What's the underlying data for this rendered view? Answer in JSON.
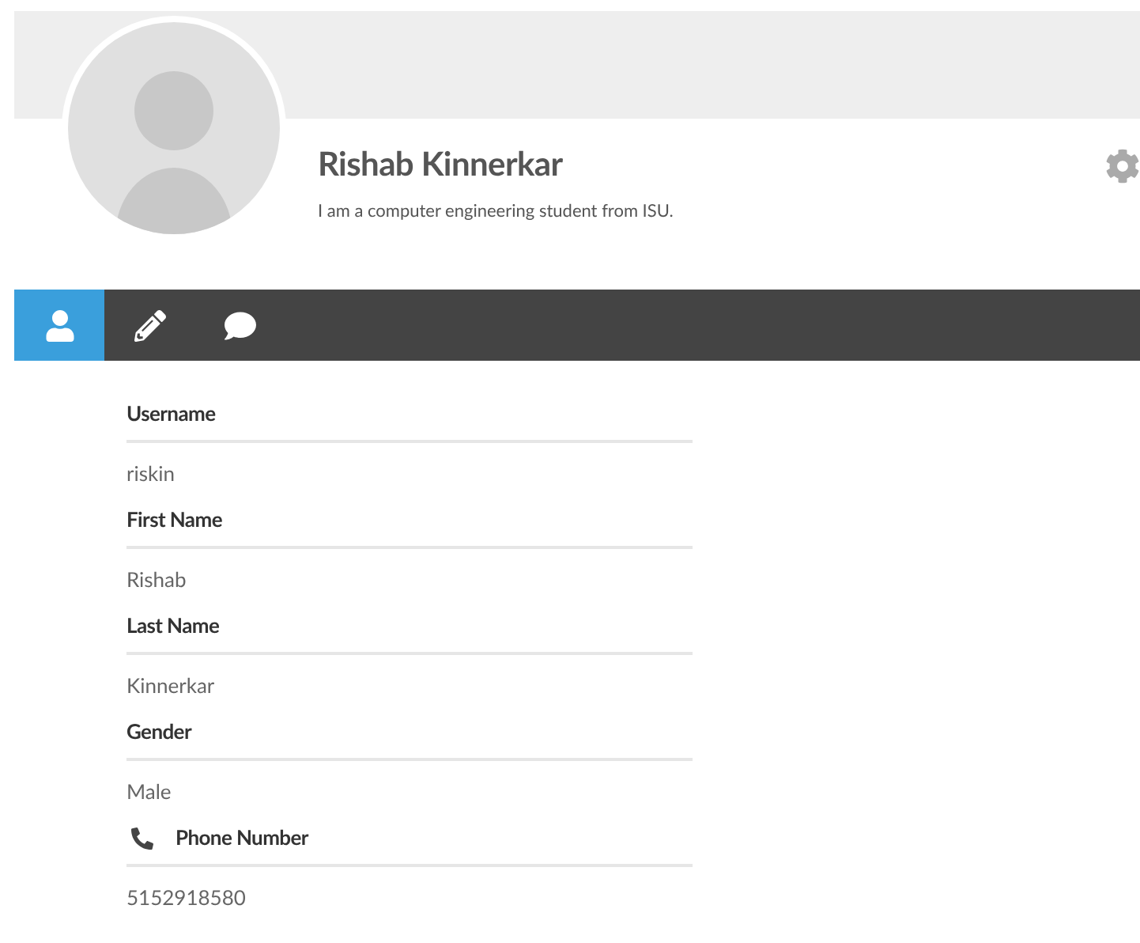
{
  "profile": {
    "name": "Rishab Kinnerkar",
    "bio": "I am a computer engineering student from ISU."
  },
  "tabs": [
    {
      "kind": "user",
      "selected": true
    },
    {
      "kind": "pencil",
      "selected": false
    },
    {
      "kind": "chat",
      "selected": false
    }
  ],
  "fields": [
    {
      "kind": "text",
      "label": "Username",
      "value": "riskin"
    },
    {
      "kind": "text",
      "label": "First Name",
      "value": "Rishab"
    },
    {
      "kind": "text",
      "label": "Last Name",
      "value": "Kinnerkar"
    },
    {
      "kind": "text",
      "label": "Gender",
      "value": "Male"
    },
    {
      "kind": "phone",
      "label": "Phone Number",
      "value": "5152918580"
    }
  ]
}
